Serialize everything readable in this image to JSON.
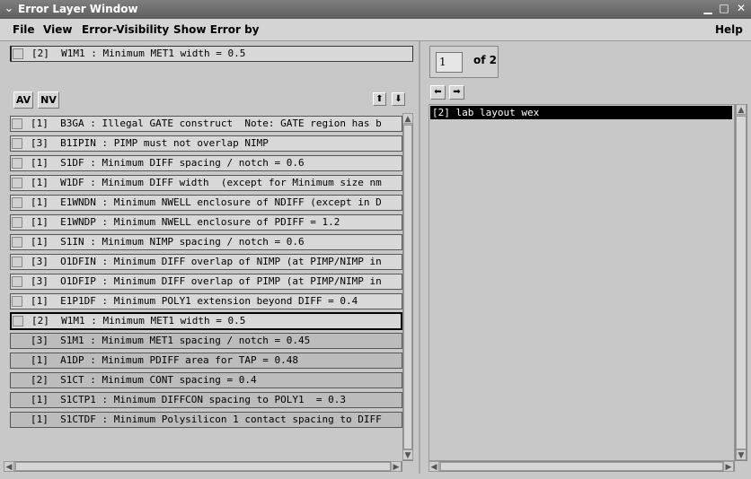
{
  "window": {
    "title": "Error Layer Window",
    "menu_glyph": "⌄",
    "minimize_glyph": "▁",
    "maximize_glyph": "□",
    "close_glyph": "✕"
  },
  "menubar": {
    "file": "File",
    "view": "View",
    "error_visibility": "Error-Visibility",
    "show_error_by": "Show Error by",
    "help": "Help"
  },
  "selected_error": "[2]  W1M1 : Minimum MET1 width = 0.5",
  "toolbar": {
    "av": "AV",
    "nv": "NV",
    "up_glyph": "⬆",
    "down_glyph": "⬇"
  },
  "errors": [
    "[1]  B3GA : Illegal GATE construct  Note: GATE region has b",
    "[3]  B1IPIN : PIMP must not overlap NIMP",
    "[1]  S1DF : Minimum DIFF spacing / notch = 0.6",
    "[1]  W1DF : Minimum DIFF width  (except for Minimum size nm",
    "[1]  E1WNDN : Minimum NWELL enclosure of NDIFF (except in D",
    "[1]  E1WNDP : Minimum NWELL enclosure of PDIFF = 1.2",
    "[1]  S1IN : Minimum NIMP spacing / notch = 0.6",
    "[3]  O1DFIN : Minimum DIFF overlap of NIMP (at PIMP/NIMP in",
    "[3]  O1DFIP : Minimum DIFF overlap of PIMP (at PIMP/NIMP in",
    "[1]  E1P1DF : Minimum POLY1 extension beyond DIFF = 0.4",
    "[2]  W1M1 : Minimum MET1 width = 0.5",
    "[3]  S1M1 : Minimum MET1 spacing / notch = 0.45",
    "[1]  A1DP : Minimum PDIFF area for TAP = 0.48",
    "[2]  S1CT : Minimum CONT spacing = 0.4",
    "[1]  S1CTP1 : Minimum DIFFCON spacing to POLY1  = 0.3",
    "[1]  S1CTDF : Minimum Polysilicon 1 contact spacing to DIFF"
  ],
  "pager": {
    "current_page": "1",
    "of_label": "of 2",
    "prev_glyph": "⬅",
    "next_glyph": "➡"
  },
  "results": {
    "items": [
      "[2] lab layout wex"
    ]
  },
  "scroll": {
    "up_glyph": "▲",
    "down_glyph": "▼",
    "left_glyph": "◀",
    "right_glyph": "▶"
  },
  "colors": {
    "titlebar": "#6e6e6e",
    "selected_result_bg": "#000000",
    "selected_result_fg": "#ffffff"
  }
}
